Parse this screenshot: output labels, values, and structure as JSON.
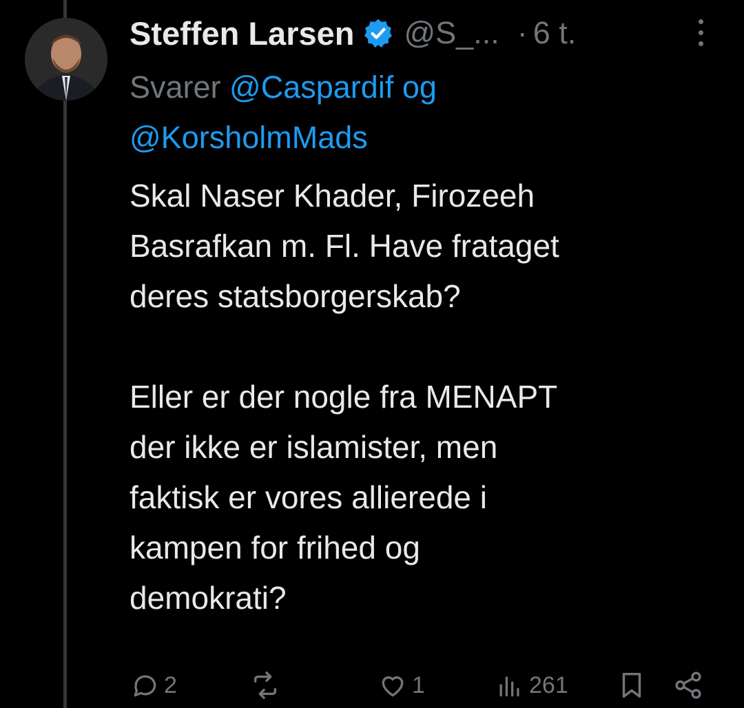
{
  "author": {
    "name": "Steffen Larsen",
    "handle": "@S_...",
    "time_sep": "·",
    "time": "6 t."
  },
  "reply": {
    "prefix": "Svarer ",
    "mention1": "@Caspardif",
    "joiner": " og",
    "mention2": "@KorsholmMads"
  },
  "tweet": {
    "text": "Skal Naser Khader, Firozeeh\nBasrafkan m. Fl. Have frataget\nderes statsborgerskab?\n\nEller er der nogle fra MENAPT\nder ikke er islamister, men\nfaktisk er vores allierede i\nkampen for frihed og\ndemokrati?"
  },
  "actions": {
    "replies": "2",
    "retweets": "",
    "likes": "1",
    "views": "261"
  },
  "colors": {
    "background": "#000000",
    "text": "#e7e9ea",
    "muted": "#71767b",
    "link": "#1d9bf0",
    "thread_line": "#333639"
  },
  "icons": {
    "verified": "verified-badge-icon",
    "more": "more-vertical-icon",
    "reply": "reply-icon",
    "retweet": "retweet-icon",
    "like": "heart-icon",
    "views": "views-chart-icon",
    "bookmark": "bookmark-icon",
    "share": "share-icon"
  }
}
